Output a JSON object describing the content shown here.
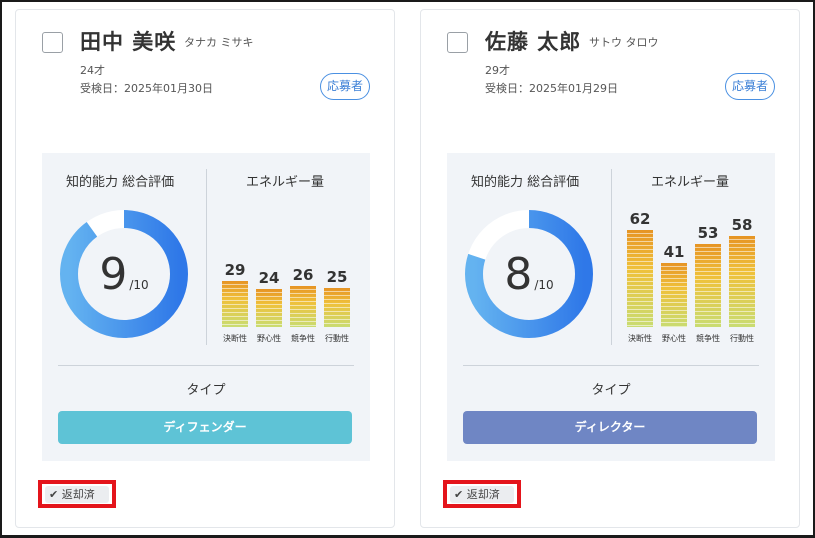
{
  "colors": {
    "donut_track": "#ffffff",
    "donut_start": "#64b3f0",
    "donut_end": "#2f78e8",
    "badge": "#3b7fd6",
    "highlight_box": "#e4141b"
  },
  "labels": {
    "intelligence_title": "知的能力 総合評価",
    "energy_title": "エネルギー量",
    "type_title": "タイプ",
    "score_denominator": "/10",
    "applicant_badge": "応募者",
    "returned_status": "返却済",
    "check_icon": "✔"
  },
  "candidates": [
    {
      "name": "田中 美咲",
      "kana": "タナカ ミサキ",
      "age": "24才",
      "exam_date": "受検日：2025年01月30日",
      "score": 9,
      "score_max": 10,
      "energy": [
        {
          "label": "決断性",
          "value": 29
        },
        {
          "label": "野心性",
          "value": 24
        },
        {
          "label": "競争性",
          "value": 26
        },
        {
          "label": "行動性",
          "value": 25
        }
      ],
      "type": "ディフェンダー",
      "type_color": "#5ec3d6"
    },
    {
      "name": "佐藤 太郎",
      "kana": "サトウ タロウ",
      "age": "29才",
      "exam_date": "受検日：2025年01月29日",
      "score": 8,
      "score_max": 10,
      "energy": [
        {
          "label": "決断性",
          "value": 62
        },
        {
          "label": "野心性",
          "value": 41
        },
        {
          "label": "競争性",
          "value": 53
        },
        {
          "label": "行動性",
          "value": 58
        }
      ],
      "type": "ディレクター",
      "type_color": "#6f86c4"
    }
  ]
}
